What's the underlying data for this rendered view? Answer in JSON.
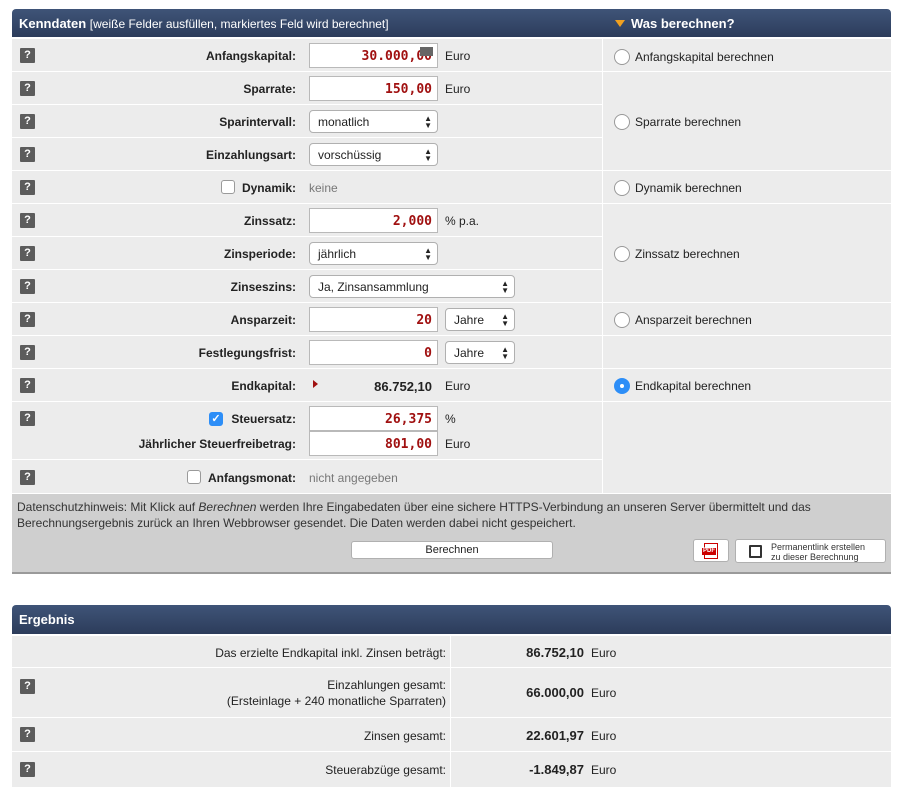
{
  "kenndaten": {
    "title": "Kenndaten",
    "subtitle": "[weiße Felder ausfüllen, markiertes Feld wird berechnet]",
    "was_berechnen": "Was berechnen?",
    "help": "?",
    "anfangskapital": {
      "label": "Anfangskapital:",
      "value": "30.000,00",
      "unit": "Euro"
    },
    "sparrate": {
      "label": "Sparrate:",
      "value": "150,00",
      "unit": "Euro"
    },
    "sparintervall": {
      "label": "Sparintervall:",
      "value": "monatlich"
    },
    "einzahlungsart": {
      "label": "Einzahlungsart:",
      "value": "vorschüssig"
    },
    "dynamik": {
      "label": "Dynamik:",
      "value": "keine",
      "checked": false
    },
    "zinssatz": {
      "label": "Zinssatz:",
      "value": "2,000",
      "unit": "% p.a."
    },
    "zinsperiode": {
      "label": "Zinsperiode:",
      "value": "jährlich"
    },
    "zinseszins": {
      "label": "Zinseszins:",
      "value": "Ja, Zinsansammlung"
    },
    "ansparzeit": {
      "label": "Ansparzeit:",
      "value": "20",
      "unit": "Jahre"
    },
    "festlegungsfrist": {
      "label": "Festlegungsfrist:",
      "value": "0",
      "unit": "Jahre"
    },
    "endkapital": {
      "label": "Endkapital:",
      "value": "86.752,10",
      "unit": "Euro"
    },
    "steuersatz": {
      "label": "Steuersatz:",
      "value": "26,375",
      "unit": "%",
      "checked": true
    },
    "freibetrag": {
      "label": "Jährlicher Steuerfreibetrag:",
      "value": "801,00",
      "unit": "Euro"
    },
    "anfangsmonat": {
      "label": "Anfangsmonat:",
      "value": "nicht angegeben",
      "checked": false
    }
  },
  "options": {
    "anfangskapital": "Anfangskapital berechnen",
    "sparrate": "Sparrate berechnen",
    "dynamik": "Dynamik berechnen",
    "zinssatz": "Zinssatz berechnen",
    "ansparzeit": "Ansparzeit berechnen",
    "endkapital": "Endkapital berechnen",
    "selected": "endkapital"
  },
  "note": {
    "before": "Datenschutzhinweis: Mit Klick auf ",
    "em": "Berechnen",
    "after": " werden Ihre Eingabedaten über eine sichere HTTPS-Verbindung an unseren Server übermittelt und das Berechnungsergebnis zurück an Ihren Webbrowser gesendet. Die Daten werden dabei nicht gespeichert."
  },
  "buttons": {
    "berechnen": "Berechnen",
    "pdf": "PDF",
    "permalink_line1": "Permanentlink erstellen",
    "permalink_line2": "zu dieser Berechnung"
  },
  "ergebnis": {
    "title": "Ergebnis",
    "rows": [
      {
        "label": "Das erzielte Endkapital inkl. Zinsen beträgt:",
        "value": "86.752,10",
        "unit": "Euro"
      },
      {
        "label": "Einzahlungen gesamt:",
        "label2": "(Ersteinlage + 240 monatliche Sparraten)",
        "value": "66.000,00",
        "unit": "Euro"
      },
      {
        "label": "Zinsen gesamt:",
        "value": "22.601,97",
        "unit": "Euro"
      },
      {
        "label": "Steuerabzüge gesamt:",
        "value": "-1.849,87",
        "unit": "Euro"
      }
    ]
  },
  "colors": {
    "header": "#34476a",
    "accent": "#f0a020",
    "input_value": "#a01010",
    "radio_selected": "#2d8ef7"
  }
}
